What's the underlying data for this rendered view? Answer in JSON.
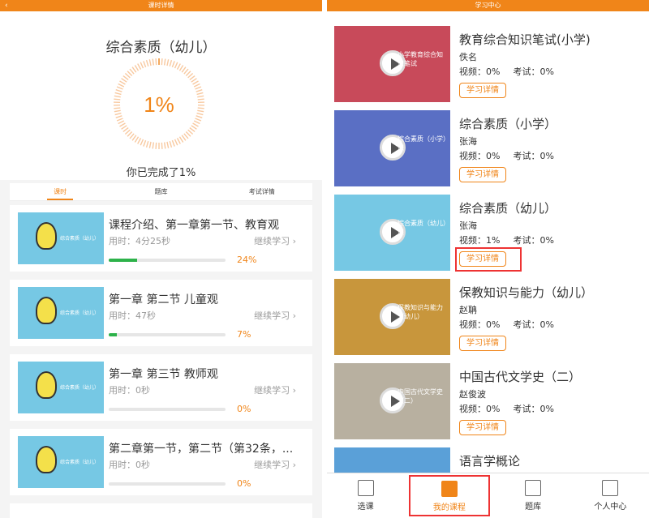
{
  "left": {
    "topbar_title": "课时详情",
    "back_icon": "‹",
    "course_title": "综合素质（幼儿）",
    "progress_percent": 1,
    "progress_label": "1%",
    "done_text": "你已完成了1%",
    "tabs": [
      {
        "label": "课时",
        "active": true
      },
      {
        "label": "题库",
        "active": false
      },
      {
        "label": "考试详情",
        "active": false
      }
    ],
    "lessons": [
      {
        "title": "课程介绍、第一章第一节、教育观",
        "time": "用时：4分25秒",
        "continue": "继续学习 ›",
        "percent": 24,
        "percent_label": "24%",
        "thumb_text": "综合素质（幼儿）"
      },
      {
        "title": "第一章 第二节 儿童观",
        "time": "用时：47秒",
        "continue": "继续学习 ›",
        "percent": 7,
        "percent_label": "7%",
        "thumb_text": "综合素质（幼儿）"
      },
      {
        "title": "第一章 第三节 教师观",
        "time": "用时：0秒",
        "continue": "继续学习 ›",
        "percent": 0,
        "percent_label": "0%",
        "thumb_text": "综合素质（幼儿）"
      },
      {
        "title": "第二章第一节，第二节（第32条，...",
        "time": "用时：0秒",
        "continue": "继续学习 ›",
        "percent": 0,
        "percent_label": "0%",
        "thumb_text": "综合素质（幼儿）"
      }
    ]
  },
  "right": {
    "topbar_title": "学习中心",
    "courses": [
      {
        "title": "教育综合知识笔试(小学)",
        "teacher": "佚名",
        "video": "视频：0%",
        "exam": "考试：0%",
        "button": "学习详情",
        "thumb_color": "#c84a5a",
        "thumb_text": "小学教育综合知识笔试"
      },
      {
        "title": "综合素质（小学）",
        "teacher": "张海",
        "video": "视频：0%",
        "exam": "考试：0%",
        "button": "学习详情",
        "thumb_color": "#5a6fc4",
        "thumb_text": "综合素质（小学）课"
      },
      {
        "title": "综合素质（幼儿）",
        "teacher": "张海",
        "video": "视频：1%",
        "exam": "考试：0%",
        "button": "学习详情",
        "thumb_color": "#76c8e4",
        "thumb_text": "综合素质（幼儿）课"
      },
      {
        "title": "保教知识与能力（幼儿）",
        "teacher": "赵聃",
        "video": "视频：0%",
        "exam": "考试：0%",
        "button": "学习详情",
        "thumb_color": "#c8963c",
        "thumb_text": "保教知识与能力（幼儿）"
      },
      {
        "title": "中国古代文学史（二）",
        "teacher": "赵俊波",
        "video": "视频：0%",
        "exam": "考试：0%",
        "button": "学习详情",
        "thumb_color": "#b8b0a0",
        "thumb_text": "中国古代文学史（二）"
      },
      {
        "title": "语言学概论",
        "teacher": "",
        "video": "",
        "exam": "",
        "button": "",
        "thumb_color": "#5aa0d8",
        "thumb_text": ""
      }
    ],
    "nav": [
      {
        "label": "选课",
        "icon": "list-icon",
        "active": false
      },
      {
        "label": "我的课程",
        "icon": "book-icon",
        "active": true
      },
      {
        "label": "题库",
        "icon": "question-bank-icon",
        "active": false
      },
      {
        "label": "个人中心",
        "icon": "home-icon",
        "active": false
      }
    ],
    "accent_color": "#f08519"
  }
}
